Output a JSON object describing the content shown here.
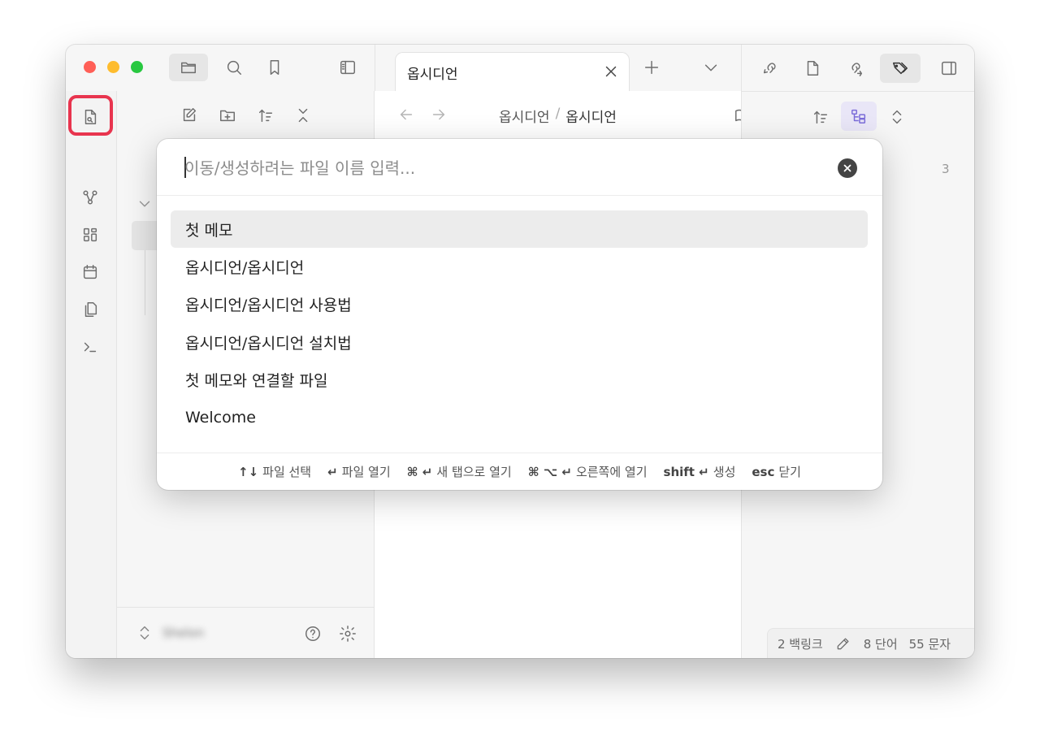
{
  "tab": {
    "title": "옵시디언"
  },
  "breadcrumb": {
    "folder": "옵시디언",
    "separator": "/",
    "file": "옵시디언"
  },
  "right_panel": {
    "count": "3"
  },
  "vault": {
    "name": "Shelon"
  },
  "switcher": {
    "placeholder": "이동/생성하려는 파일 이름 입력...",
    "results": [
      "첫 메모",
      "옵시디언/옵시디언",
      "옵시디언/옵시디언 사용법",
      "옵시디언/옵시디언 설치법",
      "첫 메모와 연결할 파일",
      "Welcome"
    ],
    "selected_index": 0,
    "hints": [
      {
        "key": "↑↓",
        "label": "파일 선택"
      },
      {
        "key": "↵",
        "label": "파일 열기"
      },
      {
        "key": "⌘ ↵",
        "label": "새 탭으로 열기"
      },
      {
        "key": "⌘ ⌥ ↵",
        "label": "오른쪽에 열기"
      },
      {
        "key": "shift ↵",
        "label": "생성"
      },
      {
        "key": "esc",
        "label": "닫기"
      }
    ]
  },
  "status_bar": {
    "backlinks": "2 백링크",
    "words": "8 단어",
    "chars": "55 문자"
  },
  "colors": {
    "highlight": "#e8344e",
    "accent": "#7b6cd9",
    "close": "#ff5f57",
    "minimize": "#febc2e",
    "zoom": "#28c840"
  },
  "icons": [
    "folder-icon",
    "search-icon",
    "bookmark-icon",
    "sidebar-toggle-icon",
    "quick-switcher-icon",
    "graph-icon",
    "canvas-icon",
    "calendar-icon",
    "copy-icon",
    "terminal-icon",
    "new-note-icon",
    "new-folder-icon",
    "sort-icon",
    "collapse-icon",
    "backlinks-icon",
    "file-icon",
    "outgoing-links-icon",
    "tags-icon",
    "right-sidebar-icon",
    "help-icon",
    "settings-icon",
    "edit-icon"
  ]
}
